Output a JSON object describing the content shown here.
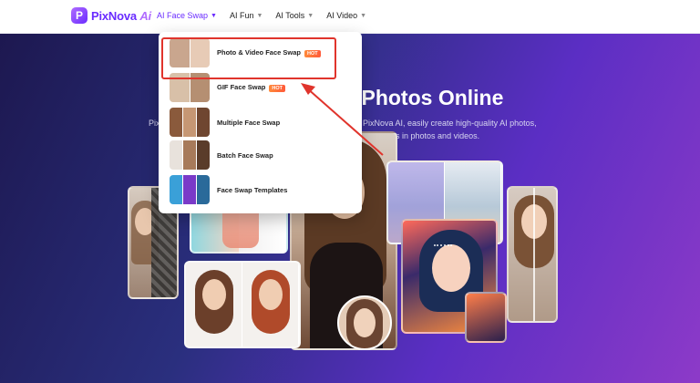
{
  "brand": {
    "logo_letter": "P",
    "name": "PixNova",
    "suffix": "Ai",
    "accent_color": "#6a2cff"
  },
  "nav": {
    "items": [
      {
        "label": "AI Face Swap",
        "active": true
      },
      {
        "label": "AI Fun",
        "active": false
      },
      {
        "label": "AI Tools",
        "active": false
      },
      {
        "label": "AI Video",
        "active": false
      }
    ]
  },
  "dropdown": {
    "items": [
      {
        "label": "Photo & Video Face Swap",
        "badge": "HOT",
        "icon": "face-swap-thumb"
      },
      {
        "label": "GIF Face Swap",
        "badge": "HOT",
        "icon": "gif-thumb"
      },
      {
        "label": "Multiple Face Swap",
        "badge": "",
        "icon": "multi-face-thumb"
      },
      {
        "label": "Batch Face Swap",
        "badge": "",
        "icon": "batch-thumb"
      },
      {
        "label": "Face Swap Templates",
        "badge": "",
        "icon": "templates-thumb"
      }
    ],
    "highlight_color": "#e0342c"
  },
  "hero": {
    "title_fragment": "ng Photos Online",
    "sub_left": "Pix",
    "sub_line1": "ith PixNova AI, easily create high-quality AI photos,",
    "sub_line2": "n face swaps in photos and videos."
  }
}
